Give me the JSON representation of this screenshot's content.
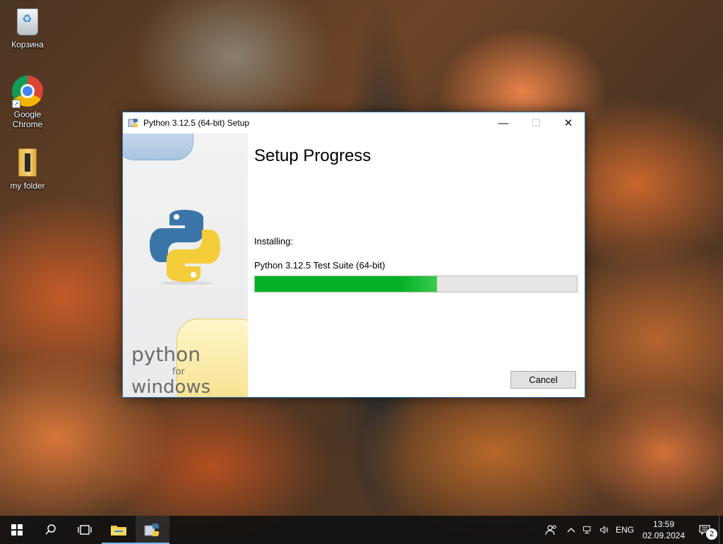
{
  "desktop": {
    "icons": [
      {
        "label": "Корзина",
        "icon": "recycle-bin-icon"
      },
      {
        "label": "Google Chrome",
        "icon": "chrome-icon"
      },
      {
        "label": "my folder",
        "icon": "folder-icon"
      }
    ]
  },
  "window": {
    "title": "Python 3.12.5 (64-bit) Setup",
    "controls": {
      "minimize": "—",
      "maximize": "☐",
      "close": "✕"
    },
    "sidebar": {
      "brand_word1": "python",
      "brand_word2": "for",
      "brand_word3": "windows"
    },
    "heading": "Setup Progress",
    "status_label": "Installing:",
    "current_package": "Python 3.12.5 Test Suite (64-bit)",
    "progress_fraction": 0.565,
    "cancel_label": "Cancel"
  },
  "taskbar": {
    "buttons": [
      {
        "name": "start-button",
        "icon": "windows-logo-icon"
      },
      {
        "name": "search-button",
        "icon": "search-icon"
      },
      {
        "name": "task-view-button",
        "icon": "task-view-icon"
      },
      {
        "name": "file-explorer-button",
        "icon": "folder-icon"
      },
      {
        "name": "python-setup-taskbar-button",
        "icon": "python-installer-icon"
      }
    ],
    "tray": {
      "people_icon": "people-icon",
      "chevron": "^",
      "network_icon": "network-icon",
      "volume_icon": "speaker-icon",
      "language": "ENG",
      "time": "13:59",
      "date": "02.09.2024",
      "notifications_count": "2"
    }
  },
  "colors": {
    "progress_fill": "#06b025",
    "window_border": "#1f6fb2",
    "taskbar_accent": "#76b9ed"
  }
}
